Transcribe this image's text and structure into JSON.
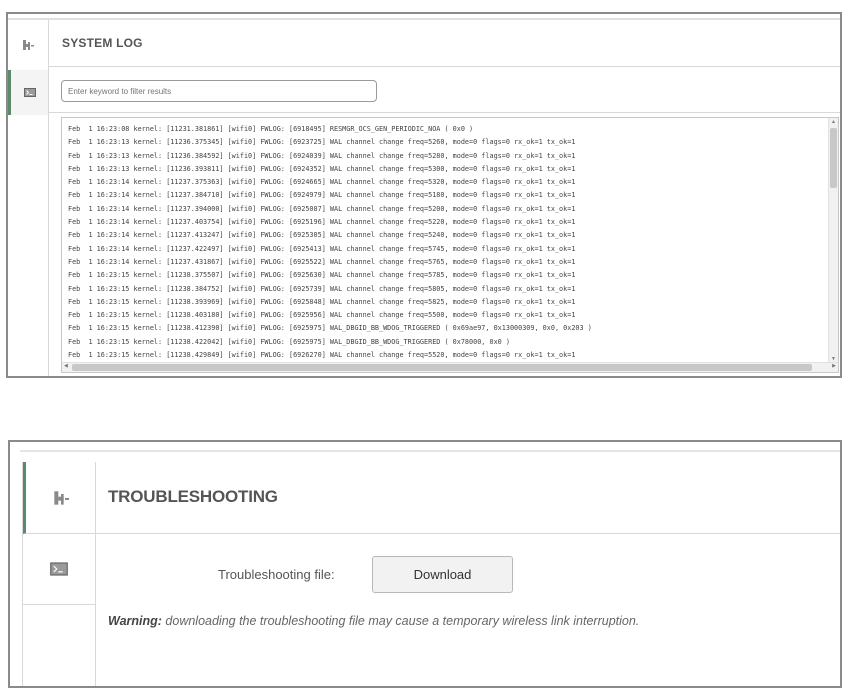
{
  "system_log": {
    "title": "SYSTEM LOG",
    "filter_placeholder": "Enter keyword to filter results",
    "lines": [
      "Feb  1 16:23:08 kernel: [11231.381861] [wifi0] FWLOG: [6918495] RESMGR_OCS_GEN_PERIODIC_NOA ( 0x0 )",
      "Feb  1 16:23:13 kernel: [11236.375345] [wifi0] FWLOG: [6923725] WAL channel change freq=5260, mode=0 flags=0 rx_ok=1 tx_ok=1",
      "Feb  1 16:23:13 kernel: [11236.384592] [wifi0] FWLOG: [6924039] WAL channel change freq=5280, mode=0 flags=0 rx_ok=1 tx_ok=1",
      "Feb  1 16:23:13 kernel: [11236.393811] [wifi0] FWLOG: [6924352] WAL channel change freq=5300, mode=0 flags=0 rx_ok=1 tx_ok=1",
      "Feb  1 16:23:14 kernel: [11237.375363] [wifi0] FWLOG: [6924665] WAL channel change freq=5320, mode=0 flags=0 rx_ok=1 tx_ok=1",
      "Feb  1 16:23:14 kernel: [11237.384710] [wifi0] FWLOG: [6924979] WAL channel change freq=5180, mode=0 flags=0 rx_ok=1 tx_ok=1",
      "Feb  1 16:23:14 kernel: [11237.394000] [wifi0] FWLOG: [6925087] WAL channel change freq=5200, mode=0 flags=0 rx_ok=1 tx_ok=1",
      "Feb  1 16:23:14 kernel: [11237.403754] [wifi0] FWLOG: [6925196] WAL channel change freq=5220, mode=0 flags=0 rx_ok=1 tx_ok=1",
      "Feb  1 16:23:14 kernel: [11237.413247] [wifi0] FWLOG: [6925305] WAL channel change freq=5240, mode=0 flags=0 rx_ok=1 tx_ok=1",
      "Feb  1 16:23:14 kernel: [11237.422497] [wifi0] FWLOG: [6925413] WAL channel change freq=5745, mode=0 flags=0 rx_ok=1 tx_ok=1",
      "Feb  1 16:23:14 kernel: [11237.431867] [wifi0] FWLOG: [6925522] WAL channel change freq=5765, mode=0 flags=0 rx_ok=1 tx_ok=1",
      "Feb  1 16:23:15 kernel: [11238.375507] [wifi0] FWLOG: [6925630] WAL channel change freq=5785, mode=0 flags=0 rx_ok=1 tx_ok=1",
      "Feb  1 16:23:15 kernel: [11238.384752] [wifi0] FWLOG: [6925739] WAL channel change freq=5805, mode=0 flags=0 rx_ok=1 tx_ok=1",
      "Feb  1 16:23:15 kernel: [11238.393969] [wifi0] FWLOG: [6925848] WAL channel change freq=5825, mode=0 flags=0 rx_ok=1 tx_ok=1",
      "Feb  1 16:23:15 kernel: [11238.403180] [wifi0] FWLOG: [6925956] WAL channel change freq=5500, mode=0 flags=0 rx_ok=1 tx_ok=1",
      "Feb  1 16:23:15 kernel: [11238.412390] [wifi0] FWLOG: [6925975] WAL_DBGID_BB_WDOG_TRIGGERED ( 0x69ae97, 0x13000309, 0x0, 0x203 )",
      "Feb  1 16:23:15 kernel: [11238.422042] [wifi0] FWLOG: [6925975] WAL_DBGID_BB_WDOG_TRIGGERED ( 0x78000, 0x0 )",
      "Feb  1 16:23:15 kernel: [11238.429849] [wifi0] FWLOG: [6926270] WAL channel change freq=5520, mode=0 flags=0 rx_ok=1 tx_ok=1"
    ]
  },
  "troubleshooting": {
    "title": "TROUBLESHOOTING",
    "file_label": "Troubleshooting file:",
    "download_label": "Download",
    "warning_prefix": "Warning:",
    "warning_text": " downloading the troubleshooting file may cause a temporary wireless link interruption."
  },
  "icons": {
    "tools": "tools-icon",
    "terminal": "terminal-icon"
  },
  "colors": {
    "accent_border": "#5a8a6a",
    "icon_gray": "#8a8a8a"
  }
}
